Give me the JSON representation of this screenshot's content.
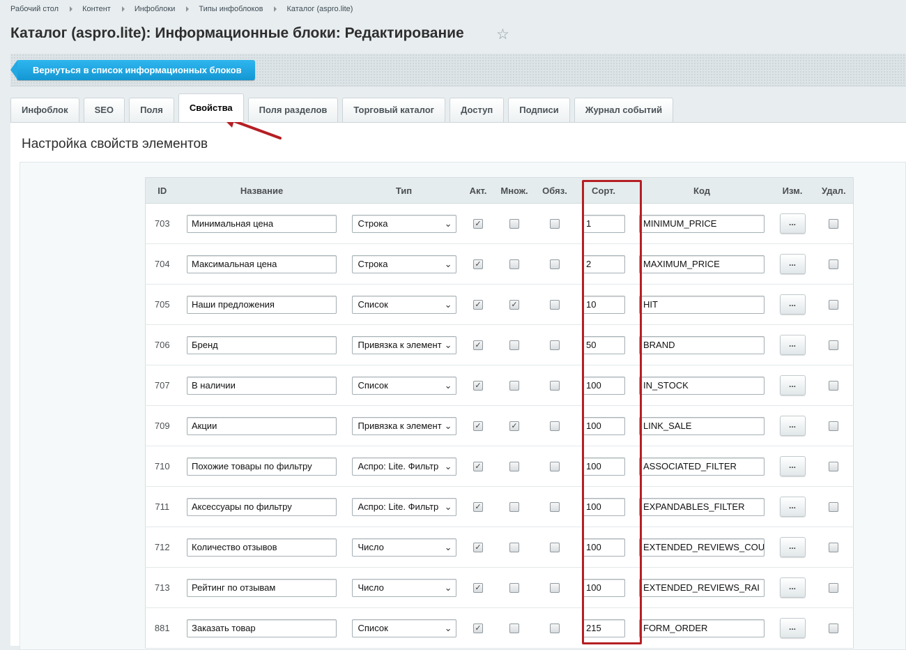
{
  "breadcrumb": [
    "Рабочий стол",
    "Контент",
    "Инфоблоки",
    "Типы инфоблоков",
    "Каталог (aspro.lite)"
  ],
  "page_title": "Каталог (aspro.lite): Информационные блоки: Редактирование",
  "toolbar": {
    "back_label": "Вернуться в список информационных блоков"
  },
  "tabs": [
    {
      "label": "Инфоблок"
    },
    {
      "label": "SEO"
    },
    {
      "label": "Поля"
    },
    {
      "label": "Свойства",
      "active": true
    },
    {
      "label": "Поля разделов"
    },
    {
      "label": "Торговый каталог"
    },
    {
      "label": "Доступ"
    },
    {
      "label": "Подписи"
    },
    {
      "label": "Журнал событий"
    }
  ],
  "section_title": "Настройка свойств элементов",
  "table": {
    "headers": [
      "ID",
      "Название",
      "Тип",
      "Акт.",
      "Множ.",
      "Обяз.",
      "Сорт.",
      "Код",
      "Изм.",
      "Удал."
    ],
    "more_label": "...",
    "rows": [
      {
        "id": "703",
        "name": "Минимальная цена",
        "type": "Строка",
        "active": true,
        "multiple": false,
        "required": false,
        "sort": "1",
        "code": "MINIMUM_PRICE"
      },
      {
        "id": "704",
        "name": "Максимальная цена",
        "type": "Строка",
        "active": true,
        "multiple": false,
        "required": false,
        "sort": "2",
        "code": "MAXIMUM_PRICE"
      },
      {
        "id": "705",
        "name": "Наши предложения",
        "type": "Список",
        "active": true,
        "multiple": true,
        "required": false,
        "sort": "10",
        "code": "HIT"
      },
      {
        "id": "706",
        "name": "Бренд",
        "type": "Привязка к элемент",
        "active": true,
        "multiple": false,
        "required": false,
        "sort": "50",
        "code": "BRAND"
      },
      {
        "id": "707",
        "name": "В наличии",
        "type": "Список",
        "active": true,
        "multiple": false,
        "required": false,
        "sort": "100",
        "code": "IN_STOCK"
      },
      {
        "id": "709",
        "name": "Акции",
        "type": "Привязка к элемент",
        "active": true,
        "multiple": true,
        "required": false,
        "sort": "100",
        "code": "LINK_SALE"
      },
      {
        "id": "710",
        "name": "Похожие товары по фильтру",
        "type": "Аспро: Lite. Фильтр",
        "active": true,
        "multiple": false,
        "required": false,
        "sort": "100",
        "code": "ASSOCIATED_FILTER"
      },
      {
        "id": "711",
        "name": "Аксессуары по фильтру",
        "type": "Аспро: Lite. Фильтр",
        "active": true,
        "multiple": false,
        "required": false,
        "sort": "100",
        "code": "EXPANDABLES_FILTER"
      },
      {
        "id": "712",
        "name": "Количество отзывов",
        "type": "Число",
        "active": true,
        "multiple": false,
        "required": false,
        "sort": "100",
        "code": "EXTENDED_REVIEWS_COU"
      },
      {
        "id": "713",
        "name": "Рейтинг по отзывам",
        "type": "Число",
        "active": true,
        "multiple": false,
        "required": false,
        "sort": "100",
        "code": "EXTENDED_REVIEWS_RAI"
      },
      {
        "id": "881",
        "name": "Заказать товар",
        "type": "Список",
        "active": true,
        "multiple": false,
        "required": false,
        "sort": "215",
        "code": "FORM_ORDER"
      }
    ]
  },
  "colors": {
    "accent_blue": "#1ea6e2",
    "annotation_red": "#b51f24"
  },
  "icons": {
    "favorite": "star-icon",
    "breadcrumb_separator": "triangle-right-icon",
    "select": "chevron-down-icon"
  }
}
